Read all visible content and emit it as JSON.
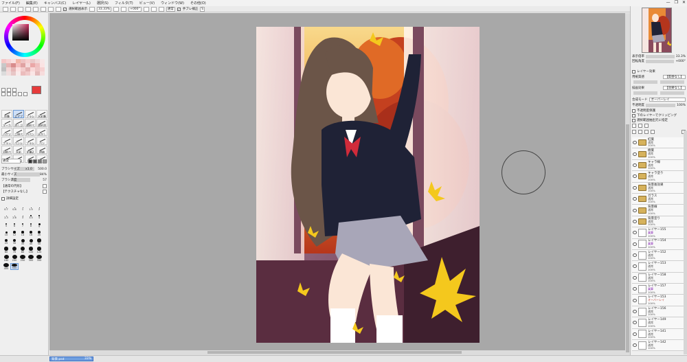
{
  "menu": {
    "items": [
      "ファイル(F)",
      "編集(E)",
      "キャンバス(C)",
      "レイヤー(L)",
      "選択(S)",
      "フィルタ(T)",
      "ビュー(V)",
      "ウィンドウ(W)",
      "その他(O)"
    ]
  },
  "window_controls": {
    "minimize": "—",
    "restore": "❐",
    "close": "✕"
  },
  "toolbar": {
    "selection_toggle_label": "選択範囲表示",
    "zoom_value": "33.33%",
    "rotation_value": "+000°",
    "blend_mode": "通常",
    "stabilizer_label": "手ブレ補正",
    "stabilizer_value": "S"
  },
  "left_panel": {
    "swatch_colors": [
      "#f5c6c6",
      "#f7d3d3",
      "#fae0e0",
      "#f3b6a8",
      "#eec2c2",
      "#f7cfcf",
      "#e9c9c9",
      "#f1d8d8",
      "#f8e6e6",
      "#c8c8c8",
      "#e8b4b4",
      "#d98c8c",
      "#f4bfbf",
      "#e0a2a2",
      "#f5dada",
      "#eaa7a7",
      "#f0c0c0",
      "#fbe3e3",
      "#bfbfbf",
      "#f4d6d6",
      "#e6b7b7",
      "#fde0e0",
      "#f3cccc",
      "#e3b0b0",
      "#f9d8d8",
      "#eec4c4",
      "#f6d1d1",
      "#dcdcdc",
      "#f0dede",
      "#e8c6c6",
      "#f9eaea",
      "#ebbcbc",
      "#f1c9c9",
      "#fae5e5",
      "#e4b9b9",
      "#f7dcdc"
    ],
    "brush_tools": [
      {
        "label": "鉛筆",
        "selected": false
      },
      {
        "label": "エアブラシ",
        "selected": true
      },
      {
        "label": "ブラシ",
        "selected": false
      },
      {
        "label": "水彩筆",
        "selected": false
      },
      {
        "label": "マーカー",
        "selected": false
      },
      {
        "label": "消しゴム",
        "selected": false
      },
      {
        "label": "選択ペン",
        "selected": false
      },
      {
        "label": "選択消し",
        "selected": false
      },
      {
        "label": "バケツ",
        "selected": false
      },
      {
        "label": "二値ペン",
        "selected": false
      },
      {
        "label": "色ペン",
        "selected": false
      },
      {
        "label": "ぼかし",
        "selected": false
      },
      {
        "label": "フラット",
        "selected": false
      },
      {
        "label": "ペンシル",
        "selected": false
      },
      {
        "label": "ブラシ2",
        "selected": false
      },
      {
        "label": "ペン",
        "selected": false
      },
      {
        "label": "羽根ペン",
        "selected": false
      },
      {
        "label": "水彩",
        "selected": false
      },
      {
        "label": "鉛筆2",
        "selected": false
      },
      {
        "label": "明暗",
        "selected": false
      },
      {
        "label": "ぼかし2",
        "selected": false
      },
      {
        "label": "水彩2",
        "selected": false
      },
      {
        "label": "細線",
        "selected": false
      },
      {
        "label": "消し2",
        "selected": false
      }
    ],
    "brush_mode": "通常",
    "brush_size_label": "ブラシサイズ",
    "brush_size_multiplier": "x1.0",
    "brush_size_value": "500.0",
    "min_size_label": "最小サイズ",
    "min_size_value": "84%",
    "density_label": "ブラシ濃度",
    "density_value": "57",
    "texture_label": "【通常の円形】",
    "texture2_label": "【テクスチャなし】",
    "detail_label": "詳細設定",
    "size_presets": [
      {
        "label": "0.7",
        "size": 1
      },
      {
        "label": "0.8",
        "size": 1
      },
      {
        "label": "1",
        "size": 1
      },
      {
        "label": "1.5",
        "size": 1
      },
      {
        "label": "2",
        "size": 1
      },
      {
        "label": "2.3",
        "size": 1
      },
      {
        "label": "2.6",
        "size": 1
      },
      {
        "label": "3",
        "size": 1
      },
      {
        "label": "3.5",
        "size": 1.5
      },
      {
        "label": "4",
        "size": 1.5
      },
      {
        "label": "5",
        "size": 2
      },
      {
        "label": "6",
        "size": 2
      },
      {
        "label": "7",
        "size": 2.5
      },
      {
        "label": "8",
        "size": 2.5
      },
      {
        "label": "9",
        "size": 3
      },
      {
        "label": "10",
        "size": 3
      },
      {
        "label": "12",
        "size": 3.5
      },
      {
        "label": "14",
        "size": 3.5
      },
      {
        "label": "16",
        "size": 4
      },
      {
        "label": "20",
        "size": 4
      },
      {
        "label": "25",
        "size": 4.5
      },
      {
        "label": "30",
        "size": 4.5
      },
      {
        "label": "35",
        "size": 5
      },
      {
        "label": "40",
        "size": 5
      },
      {
        "label": "50",
        "size": 5.5
      },
      {
        "label": "60",
        "size": 5.5
      },
      {
        "label": "70",
        "size": 6
      },
      {
        "label": "80",
        "size": 6
      },
      {
        "label": "100",
        "size": 6.5
      },
      {
        "label": "120",
        "size": 6.5
      },
      {
        "label": "160",
        "size": 7
      },
      {
        "label": "200",
        "size": 7
      },
      {
        "label": "250",
        "size": 7.5
      },
      {
        "label": "300",
        "size": 7.5
      },
      {
        "label": "350",
        "size": 8
      },
      {
        "label": "400",
        "size": 8
      },
      {
        "label": "500",
        "size": 8.5
      }
    ]
  },
  "navigator": {
    "zoom_label": "表示倍率",
    "zoom_value": "33.3%",
    "rotation_label": "回転角度",
    "rotation_value": "+000°"
  },
  "layer_panel": {
    "effect_header": "レイヤー効果",
    "texture_label": "用紙質感",
    "texture_value": "【質感なし】",
    "effect_label": "描画効果",
    "effect_value": "【効果なし】",
    "composite_label": "合成モード",
    "composite_value": "オーバーレイ",
    "opacity_label": "不透明度",
    "opacity_value": "100%",
    "option1": "不透明度保護",
    "option2": "下のレイヤーでクリッピング",
    "option3": "選択範囲抽出元に指定",
    "layers": [
      {
        "name": "紅葉",
        "mode": "通常",
        "opacity": "100%",
        "folder": true
      },
      {
        "name": "樹葉",
        "mode": "通常",
        "opacity": "100%",
        "folder": true
      },
      {
        "name": "キャラ線",
        "mode": "通常",
        "opacity": "100%",
        "folder": true
      },
      {
        "name": "キャラ塗り",
        "mode": "通常",
        "opacity": "100%",
        "folder": true
      },
      {
        "name": "背景後効果",
        "mode": "通常",
        "opacity": "100%",
        "folder": true
      },
      {
        "name": "ガラス",
        "mode": "通常",
        "opacity": "100%",
        "folder": true
      },
      {
        "name": "背景線",
        "mode": "通常",
        "opacity": "100%",
        "folder": true
      },
      {
        "name": "背景塗り",
        "mode": "通常",
        "opacity": "100%",
        "folder": true
      },
      {
        "name": "レイヤー155",
        "mode": "乗算",
        "opacity": "100%",
        "folder": false
      },
      {
        "name": "レイヤー154",
        "mode": "乗算",
        "opacity": "100%",
        "folder": false
      },
      {
        "name": "レイヤー152",
        "mode": "通常",
        "opacity": "100%",
        "folder": false
      },
      {
        "name": "レイヤー153",
        "mode": "通常",
        "opacity": "100%",
        "folder": false
      },
      {
        "name": "レイヤー158",
        "mode": "通常",
        "opacity": "100%",
        "folder": false
      },
      {
        "name": "レイヤー157",
        "mode": "乗算",
        "opacity": "100%",
        "folder": false
      },
      {
        "name": "レイヤー153",
        "mode": "オーバーレイ",
        "opacity": "100%",
        "folder": false
      },
      {
        "name": "レイヤー156",
        "mode": "通常",
        "opacity": "100%",
        "folder": false
      },
      {
        "name": "レイヤー149",
        "mode": "通常",
        "opacity": "100%",
        "folder": false
      },
      {
        "name": "レイヤー141",
        "mode": "通常",
        "opacity": "100%",
        "folder": false
      },
      {
        "name": "レイヤー142",
        "mode": "通常",
        "opacity": "100%",
        "folder": false
      }
    ]
  },
  "status": {
    "file_name": "背景.psd",
    "zoom": "33%"
  }
}
